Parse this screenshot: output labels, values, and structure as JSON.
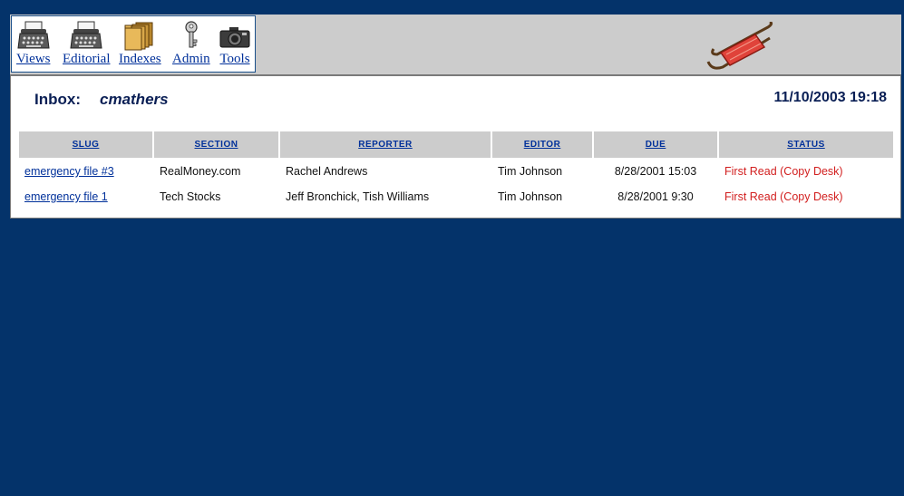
{
  "toolbar": {
    "items": [
      {
        "label": "Views",
        "icon": "typewriter-icon"
      },
      {
        "label": "Editorial",
        "icon": "typewriter-icon"
      },
      {
        "label": "Indexes",
        "icon": "file-folders-icon"
      },
      {
        "label": "Admin",
        "icon": "key-icon"
      },
      {
        "label": "Tools",
        "icon": "camera-icon"
      }
    ]
  },
  "header": {
    "inbox_label": "Inbox:",
    "user": "cmathers",
    "datetime": "11/10/2003 19:18"
  },
  "table": {
    "columns": [
      "SLUG",
      "SECTION",
      "REPORTER",
      "EDITOR",
      "DUE",
      "STATUS"
    ],
    "rows": [
      {
        "slug": "emergency file #3",
        "section": "RealMoney.com",
        "reporter": "Rachel Andrews",
        "editor": "Tim Johnson",
        "due": "8/28/2001 15:03",
        "status": "First Read (Copy Desk)"
      },
      {
        "slug": "emergency file 1",
        "section": "Tech Stocks",
        "reporter": "Jeff Bronchick, Tish Williams",
        "editor": "Tim Johnson",
        "due": "8/28/2001 9:30",
        "status": "First Read (Copy Desk)"
      }
    ]
  },
  "colors": {
    "background": "#04336a",
    "link": "#00309a",
    "status": "#d21f1f",
    "header_bg": "#cccccc"
  }
}
